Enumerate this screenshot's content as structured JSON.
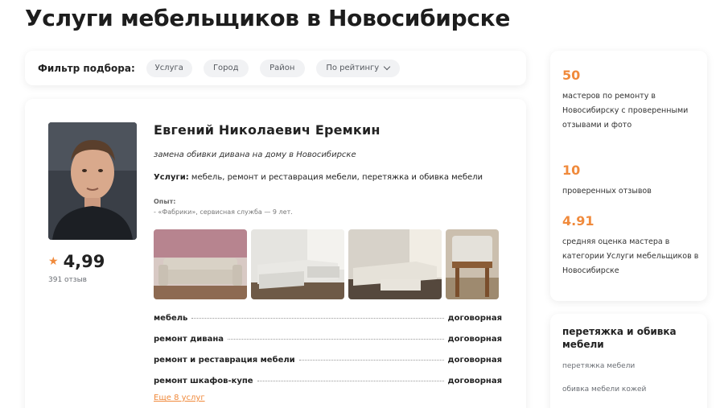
{
  "page": {
    "title": "Услуги мебельщиков в Новосибирске"
  },
  "filter": {
    "label": "Фильтр подбора:",
    "chips": [
      "Услуга",
      "Город",
      "Район",
      "По рейтингу"
    ]
  },
  "master": {
    "name": "Евгений Николаевич Еремкин",
    "tagline": "замена обивки дивана на дому в Новосибирске",
    "services_label": "Услуги:",
    "services": "мебель, ремонт и реставрация мебели, перетяжка и обивка мебели",
    "experience_title": "Опыт:",
    "experience": "- «Фабрики», сервисная служба — 9 лет.",
    "rating": "4,99",
    "reviews": "391 отзыв",
    "prices": [
      {
        "service": "мебель",
        "price": "договорная"
      },
      {
        "service": "ремонт дивана",
        "price": "договорная"
      },
      {
        "service": "ремонт и реставрация мебели",
        "price": "договорная"
      },
      {
        "service": "ремонт шкафов-купе",
        "price": "договорная"
      }
    ],
    "more_link": "Еще 8 услуг"
  },
  "stats": [
    {
      "value": "50",
      "text": "мастеров по ремонту в Новосибирску с проверенными отзывами и фото"
    },
    {
      "value": "10",
      "text": "проверенных отзывов"
    },
    {
      "value": "4.91",
      "text": "средняя оценка мастера в категории Услуги мебельщиков в Новосибирске"
    }
  ],
  "category": {
    "title": "перетяжка и обивка мебели",
    "links": [
      "перетяжка мебели",
      "обивка мебели кожей"
    ]
  },
  "colors": {
    "accent": "#f08a3c",
    "chip_bg": "#f1f2f4"
  },
  "icons": {
    "rating": "star-icon",
    "dropdown": "chevron-down-icon"
  }
}
